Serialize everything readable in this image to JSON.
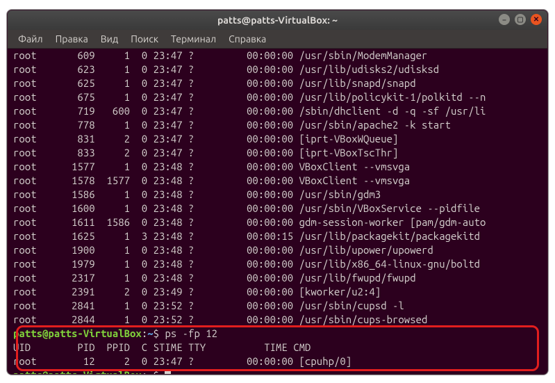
{
  "window": {
    "title": "patts@patts-VirtualBox: ~"
  },
  "menubar": {
    "file": "Файл",
    "edit": "Правка",
    "view": "Вид",
    "search": "Поиск",
    "terminal": "Терминал",
    "help": "Справка"
  },
  "ps_rows": [
    {
      "user": "root",
      "pid": "609",
      "ppid": "1",
      "c": "0",
      "stime": "23:47",
      "tty": "?",
      "time": "00:00:00",
      "cmd": "/usr/sbin/ModemManager"
    },
    {
      "user": "root",
      "pid": "623",
      "ppid": "1",
      "c": "0",
      "stime": "23:47",
      "tty": "?",
      "time": "00:00:00",
      "cmd": "/usr/lib/udisks2/udisksd"
    },
    {
      "user": "root",
      "pid": "625",
      "ppid": "1",
      "c": "0",
      "stime": "23:47",
      "tty": "?",
      "time": "00:00:00",
      "cmd": "/usr/lib/snapd/snapd"
    },
    {
      "user": "root",
      "pid": "675",
      "ppid": "1",
      "c": "0",
      "stime": "23:47",
      "tty": "?",
      "time": "00:00:00",
      "cmd": "/usr/lib/policykit-1/polkitd --n"
    },
    {
      "user": "root",
      "pid": "719",
      "ppid": "600",
      "c": "0",
      "stime": "23:47",
      "tty": "?",
      "time": "00:00:00",
      "cmd": "/sbin/dhclient -d -q -sf /usr/li"
    },
    {
      "user": "root",
      "pid": "778",
      "ppid": "1",
      "c": "0",
      "stime": "23:47",
      "tty": "?",
      "time": "00:00:00",
      "cmd": "/usr/sbin/apache2 -k start"
    },
    {
      "user": "root",
      "pid": "831",
      "ppid": "2",
      "c": "0",
      "stime": "23:47",
      "tty": "?",
      "time": "00:00:00",
      "cmd": "[iprt-VBoxWQueue]"
    },
    {
      "user": "root",
      "pid": "833",
      "ppid": "2",
      "c": "0",
      "stime": "23:47",
      "tty": "?",
      "time": "00:00:00",
      "cmd": "[iprt-VBoxTscThr]"
    },
    {
      "user": "root",
      "pid": "1577",
      "ppid": "1",
      "c": "0",
      "stime": "23:48",
      "tty": "?",
      "time": "00:00:00",
      "cmd": "VBoxClient --vmsvga"
    },
    {
      "user": "root",
      "pid": "1578",
      "ppid": "1577",
      "c": "0",
      "stime": "23:48",
      "tty": "?",
      "time": "00:00:00",
      "cmd": "VBoxClient --vmsvga"
    },
    {
      "user": "root",
      "pid": "1586",
      "ppid": "1",
      "c": "0",
      "stime": "23:48",
      "tty": "?",
      "time": "00:00:00",
      "cmd": "/usr/sbin/gdm3"
    },
    {
      "user": "root",
      "pid": "1600",
      "ppid": "1",
      "c": "0",
      "stime": "23:48",
      "tty": "?",
      "time": "00:00:00",
      "cmd": "/usr/sbin/VBoxService --pidfile"
    },
    {
      "user": "root",
      "pid": "1611",
      "ppid": "1586",
      "c": "0",
      "stime": "23:48",
      "tty": "?",
      "time": "00:00:00",
      "cmd": "gdm-session-worker [pam/gdm-auto"
    },
    {
      "user": "root",
      "pid": "1625",
      "ppid": "1",
      "c": "3",
      "stime": "23:48",
      "tty": "?",
      "time": "00:00:15",
      "cmd": "/usr/lib/packagekit/packagekitd"
    },
    {
      "user": "root",
      "pid": "1900",
      "ppid": "1",
      "c": "0",
      "stime": "23:48",
      "tty": "?",
      "time": "00:00:00",
      "cmd": "/usr/lib/upower/upowerd"
    },
    {
      "user": "root",
      "pid": "1979",
      "ppid": "1",
      "c": "0",
      "stime": "23:48",
      "tty": "?",
      "time": "00:00:00",
      "cmd": "/usr/lib/x86_64-linux-gnu/boltd"
    },
    {
      "user": "root",
      "pid": "2317",
      "ppid": "1",
      "c": "0",
      "stime": "23:48",
      "tty": "?",
      "time": "00:00:00",
      "cmd": "/usr/lib/fwupd/fwupd"
    },
    {
      "user": "root",
      "pid": "2391",
      "ppid": "2",
      "c": "0",
      "stime": "23:49",
      "tty": "?",
      "time": "00:00:00",
      "cmd": "[kworker/u2:4]"
    },
    {
      "user": "root",
      "pid": "2841",
      "ppid": "1",
      "c": "0",
      "stime": "23:52",
      "tty": "?",
      "time": "00:00:00",
      "cmd": "/usr/sbin/cupsd -l"
    },
    {
      "user": "root",
      "pid": "2844",
      "ppid": "1",
      "c": "0",
      "stime": "23:52",
      "tty": "?",
      "time": "00:00:00",
      "cmd": "/usr/sbin/cups-browsed"
    }
  ],
  "prompt": {
    "user": "patts",
    "at": "@",
    "host": "patts-VirtualBox",
    "colon": ":",
    "path": "~",
    "dollar": "$"
  },
  "command1": "ps -fp 12",
  "ps_header": {
    "uid": "UID",
    "pid": "PID",
    "ppid": "PPID",
    "c": "C",
    "stime": "STIME",
    "tty": "TTY",
    "time": "TIME",
    "cmd": "CMD"
  },
  "ps_result": {
    "user": "root",
    "pid": "12",
    "ppid": "2",
    "c": "0",
    "stime": "23:47",
    "tty": "?",
    "time": "00:00:00",
    "cmd": "[cpuhp/0]"
  }
}
